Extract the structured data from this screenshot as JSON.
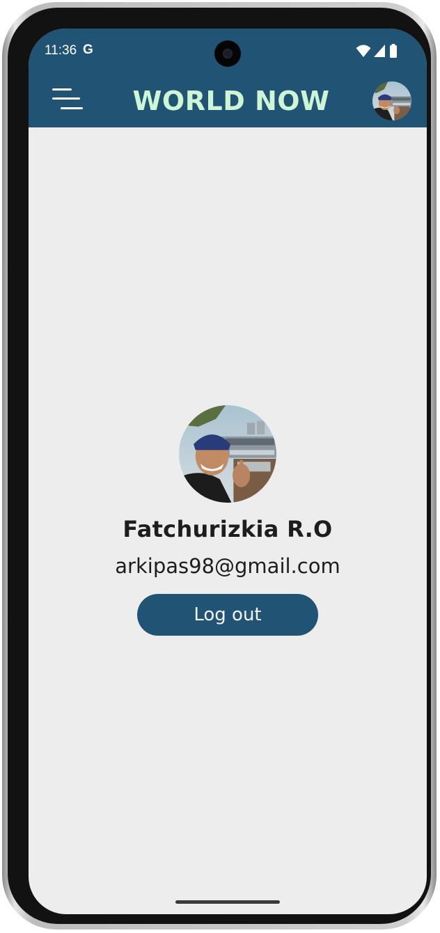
{
  "status_bar": {
    "time": "11:36",
    "google_badge": "G",
    "icons": [
      "wifi-icon",
      "cell-signal-icon",
      "battery-icon"
    ]
  },
  "app_bar": {
    "title": "WORLD NOW",
    "menu_icon": "hamburger-menu-icon",
    "avatar": "user-avatar-photo"
  },
  "profile": {
    "name": "Fatchurizkia R.O",
    "email": "arkipas98@gmail.com",
    "logout_label": "Log out"
  },
  "colors": {
    "primary": "#205374",
    "title_accent": "#cdf5d6",
    "background": "#ededed",
    "text": "#1d1d1d"
  }
}
